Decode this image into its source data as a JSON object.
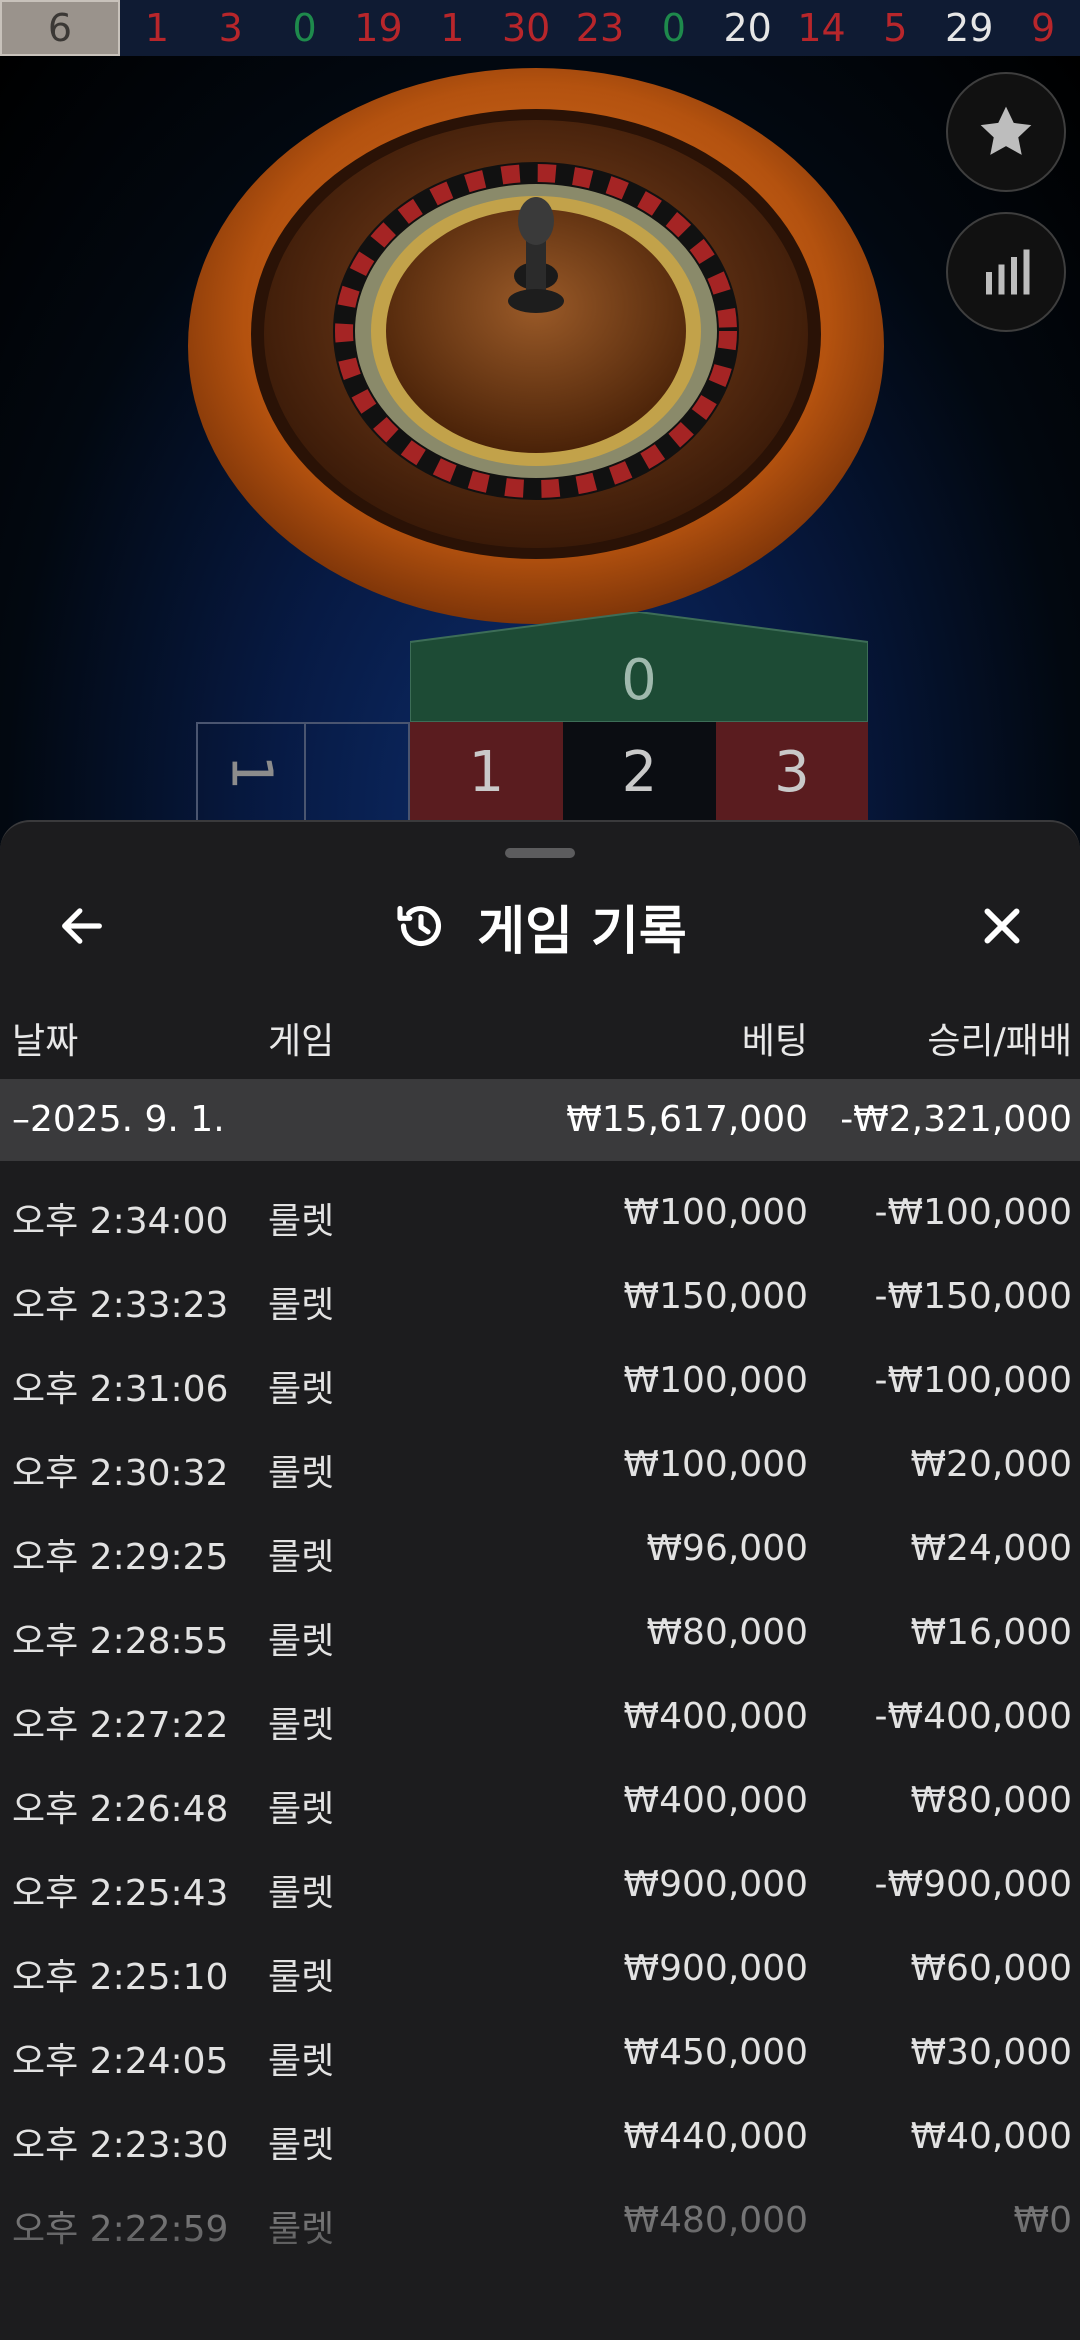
{
  "history_strip": [
    {
      "value": "6",
      "color": "highlight"
    },
    {
      "value": "1",
      "color": "red"
    },
    {
      "value": "3",
      "color": "red"
    },
    {
      "value": "0",
      "color": "green"
    },
    {
      "value": "19",
      "color": "red"
    },
    {
      "value": "1",
      "color": "red"
    },
    {
      "value": "30",
      "color": "red"
    },
    {
      "value": "23",
      "color": "red"
    },
    {
      "value": "0",
      "color": "green"
    },
    {
      "value": "20",
      "color": "black"
    },
    {
      "value": "14",
      "color": "red"
    },
    {
      "value": "5",
      "color": "red"
    },
    {
      "value": "29",
      "color": "black"
    },
    {
      "value": "9",
      "color": "red"
    }
  ],
  "side_buttons": {
    "favorite_icon": "star-icon",
    "statistics_icon": "bar-chart-icon"
  },
  "bet_table": {
    "zero": "0",
    "cells": [
      "1",
      "2",
      "3"
    ],
    "partial_label": "1"
  },
  "sheet": {
    "title": "게임 기록",
    "title_icon": "history-icon",
    "back_icon": "arrow-left-icon",
    "close_icon": "close-icon",
    "headers": {
      "date": "날짜",
      "game": "게임",
      "bet": "베팅",
      "result": "승리/패배"
    },
    "date_group": {
      "label": "–2025. 9. 1.",
      "bet": "₩15,617,000",
      "result": "-₩2,321,000"
    },
    "rows": [
      {
        "time": "오후 2:34:00",
        "game": "룰렛",
        "bet": "₩100,000",
        "result": "-₩100,000"
      },
      {
        "time": "오후 2:33:23",
        "game": "룰렛",
        "bet": "₩150,000",
        "result": "-₩150,000"
      },
      {
        "time": "오후 2:31:06",
        "game": "룰렛",
        "bet": "₩100,000",
        "result": "-₩100,000"
      },
      {
        "time": "오후 2:30:32",
        "game": "룰렛",
        "bet": "₩100,000",
        "result": "₩20,000"
      },
      {
        "time": "오후 2:29:25",
        "game": "룰렛",
        "bet": "₩96,000",
        "result": "₩24,000"
      },
      {
        "time": "오후 2:28:55",
        "game": "룰렛",
        "bet": "₩80,000",
        "result": "₩16,000"
      },
      {
        "time": "오후 2:27:22",
        "game": "룰렛",
        "bet": "₩400,000",
        "result": "-₩400,000"
      },
      {
        "time": "오후 2:26:48",
        "game": "룰렛",
        "bet": "₩400,000",
        "result": "₩80,000"
      },
      {
        "time": "오후 2:25:43",
        "game": "룰렛",
        "bet": "₩900,000",
        "result": "-₩900,000"
      },
      {
        "time": "오후 2:25:10",
        "game": "룰렛",
        "bet": "₩900,000",
        "result": "₩60,000"
      },
      {
        "time": "오후 2:24:05",
        "game": "룰렛",
        "bet": "₩450,000",
        "result": "₩30,000"
      },
      {
        "time": "오후 2:23:30",
        "game": "룰렛",
        "bet": "₩440,000",
        "result": "₩40,000"
      },
      {
        "time": "오후 2:22:59",
        "game": "룰렛",
        "bet": "₩480,000",
        "result": "₩0"
      }
    ]
  },
  "colors": {
    "red": "#b8262b",
    "green": "#1e8a4c",
    "sheet_bg": "#1c1c1e",
    "date_row_bg": "#3a3a3c"
  }
}
